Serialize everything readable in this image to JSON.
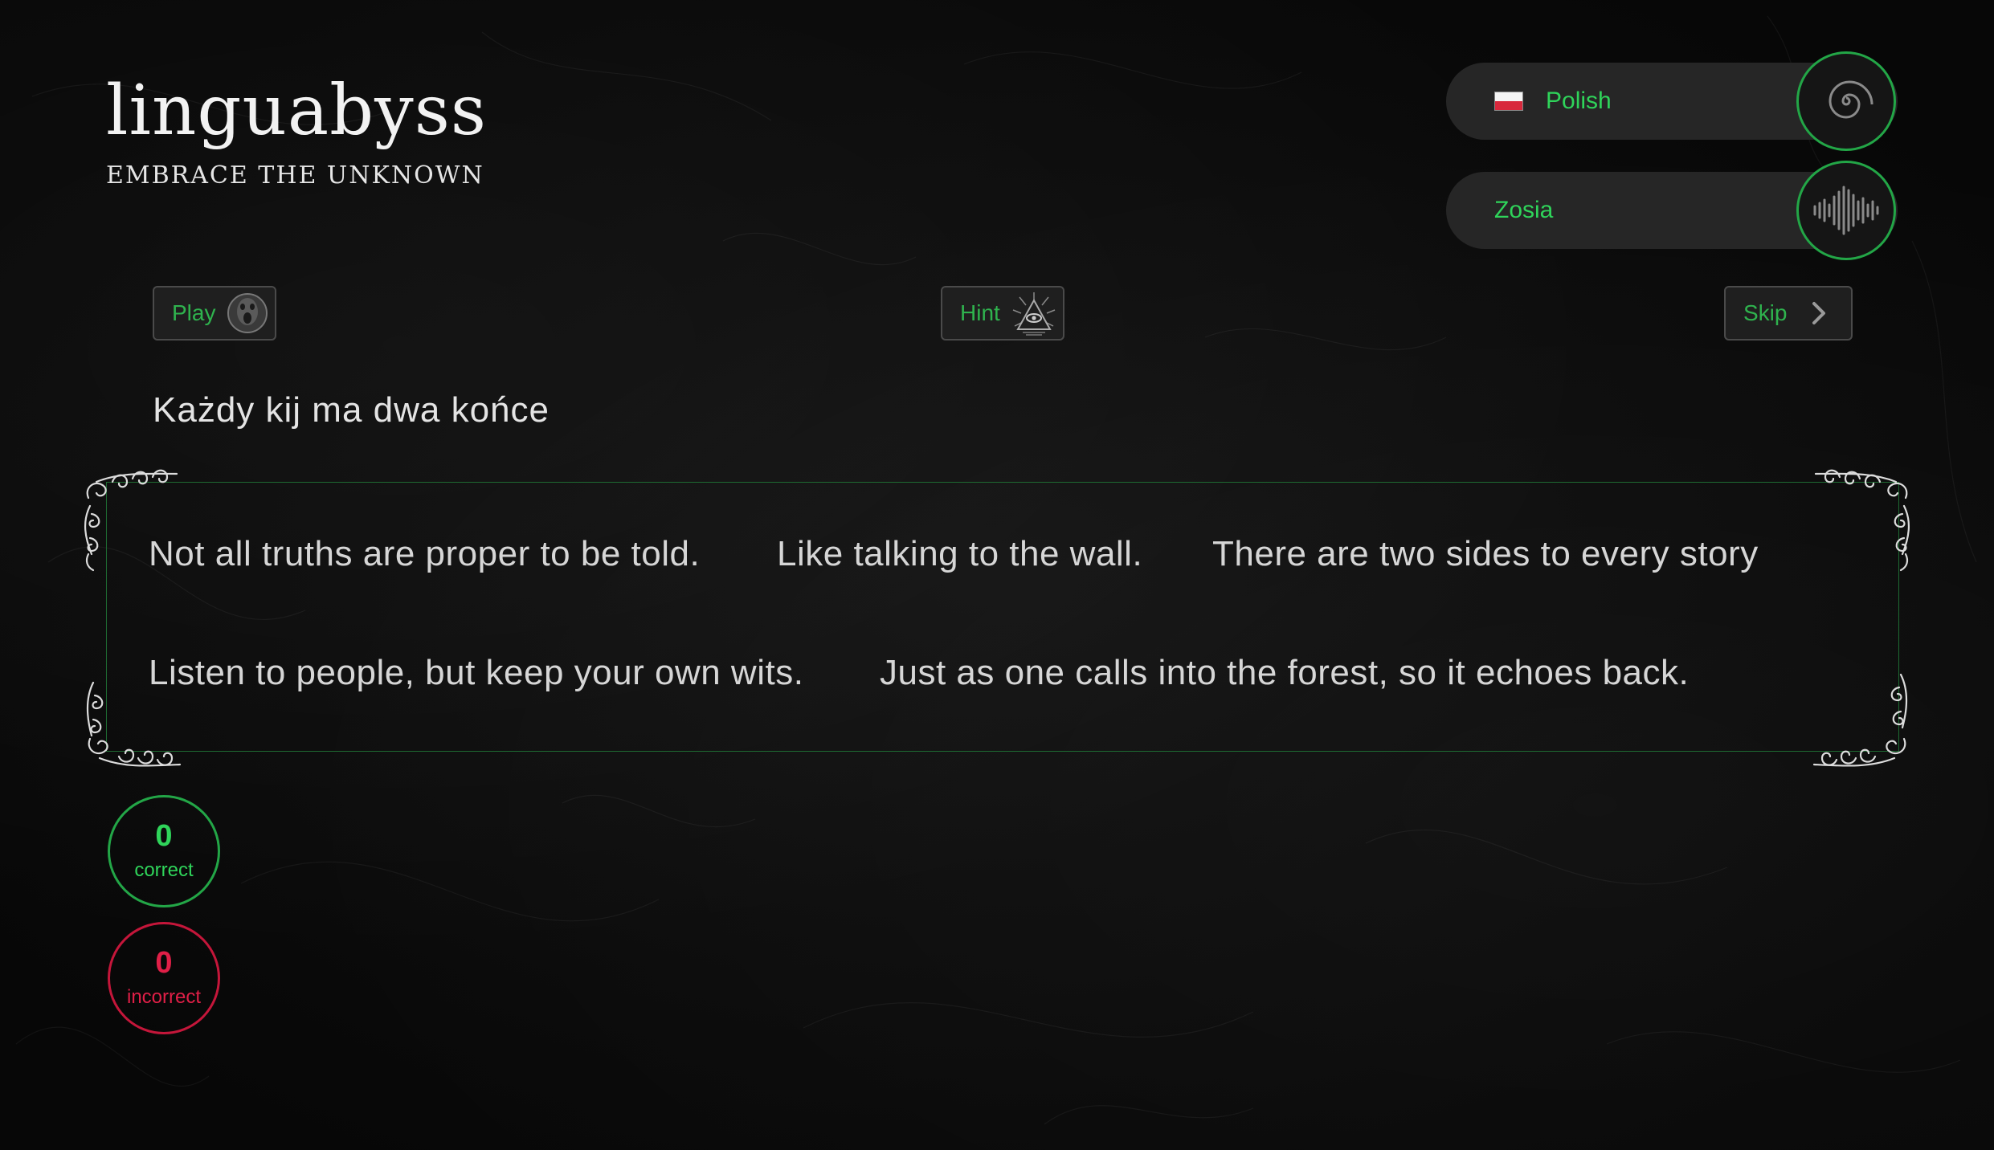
{
  "app": {
    "title": "linguabyss",
    "tagline": "EMBRACE THE UNKNOWN"
  },
  "language_selector": {
    "label": "Polish",
    "flag_icon": "poland-flag-icon",
    "icon": "spiral-icon"
  },
  "voice_selector": {
    "label": "Zosia",
    "icon": "sound-wave-icon"
  },
  "actions": {
    "play_label": "Play",
    "play_icon": "screaming-face-icon",
    "hint_label": "Hint",
    "hint_icon": "all-seeing-eye-icon",
    "skip_label": "Skip",
    "skip_icon": "chevron-right-icon"
  },
  "prompt": {
    "phrase": "Każdy kij ma dwa końce"
  },
  "options": [
    "Not all truths are proper to be told.",
    "Like talking to the wall.",
    "There are two sides to every story",
    "Listen to people, but keep your own wits.",
    "Just as one calls into the forest, so it echoes back."
  ],
  "score": {
    "correct_value": "0",
    "correct_label": "correct",
    "incorrect_value": "0",
    "incorrect_label": "incorrect"
  },
  "colors": {
    "accent_green": "#2fd45a",
    "border_green": "#23a647",
    "error_red": "#e01f47",
    "background": "#0b0b0b"
  }
}
